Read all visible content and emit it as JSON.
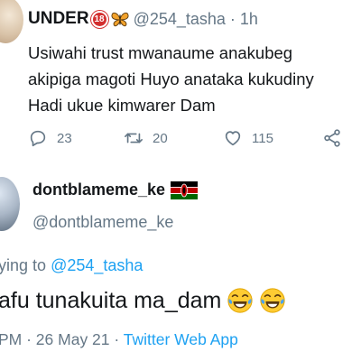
{
  "reply_tweet": {
    "display_name": "UNDER",
    "age_badge": "18",
    "butterfly_icon": "butterfly-emoji",
    "handle_time": "@254_tasha · 1h",
    "text_lines": [
      "Usiwahi trust mwanaume anakubeg",
      "akipiga magoti Huyo anataka kukudiny",
      "Hadi ukue kimwarer Dam"
    ],
    "reply_count": "23",
    "retweet_count": "20",
    "like_count": "115"
  },
  "focused_tweet": {
    "display_name": "dontblameme_ke",
    "flag_icon": "kenya-flag-emoji",
    "handle": "@dontblameme_ke",
    "replying_prefix": "ying to",
    "replying_to": "@254_tasha",
    "text": "afu tunakuita ma_dam",
    "emoji": "face-with-tears-of-joy",
    "timestamp": "PM · 26 May 21 · ",
    "source": "Twitter Web App"
  },
  "colors": {
    "text": "#14171a",
    "secondary": "#657786",
    "link": "#1da1f2",
    "badge": "#d32f2f"
  }
}
